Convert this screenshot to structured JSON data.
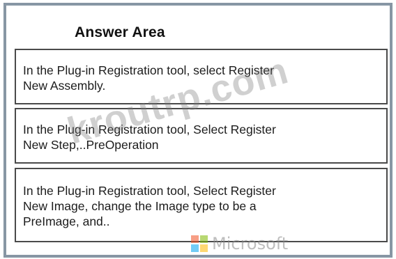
{
  "title": "Answer Area",
  "steps": [
    {
      "lines": [
        "In the Plug-in Registration tool, select Register",
        "New Assembly."
      ]
    },
    {
      "lines": [
        "In the Plug-in Registration tool, Select Register",
        "New Step,..PreOperation"
      ]
    },
    {
      "lines": [
        "In the Plug-in Registration tool, Select Register",
        "New Image, change the Image type to be a",
        "PreImage, and.."
      ]
    }
  ],
  "watermark": {
    "text": "kroutrp.com"
  },
  "logo": {
    "word": "Microsoft",
    "colors": [
      "#f25022",
      "#7fba00",
      "#00a4ef",
      "#ffb900"
    ]
  },
  "colors": {
    "frame": "#8796a4",
    "box_border": "#4a4a4a"
  }
}
